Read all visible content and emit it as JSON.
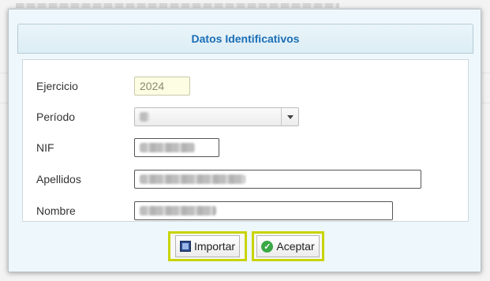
{
  "dialog": {
    "title": "Datos Identificativos"
  },
  "form": {
    "ejercicio": {
      "label": "Ejercicio",
      "value": "2024"
    },
    "periodo": {
      "label": "Período",
      "value": ""
    },
    "nif": {
      "label": "NIF",
      "value": ""
    },
    "apellidos": {
      "label": "Apellidos",
      "value": ""
    },
    "nombre": {
      "label": "Nombre",
      "value": ""
    }
  },
  "buttons": {
    "importar": "Importar",
    "aceptar": "Aceptar"
  },
  "icons": {
    "importar": "import-icon",
    "aceptar": "check-circle-icon",
    "periodo_dropdown": "chevron-down-icon"
  },
  "colors": {
    "title": "#1a6db5",
    "button_highlight": "#c8d400",
    "accept_icon": "#3aa845"
  }
}
